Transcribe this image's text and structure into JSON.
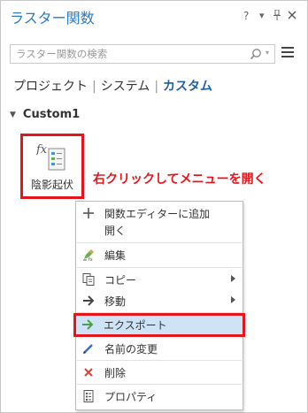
{
  "pane": {
    "title": "ラスター関数",
    "controls": {
      "help": "?",
      "menu": "▾",
      "pin": "ᵖ",
      "close": "✕"
    }
  },
  "search": {
    "placeholder": "ラスター関数の検索"
  },
  "tabs": [
    {
      "label": "プロジェクト",
      "active": false
    },
    {
      "label": "システム",
      "active": false
    },
    {
      "label": "カスタム",
      "active": true
    }
  ],
  "group": {
    "name": "Custom1",
    "expanded": true
  },
  "function": {
    "label": "陰影起伏",
    "icon_text": "fx"
  },
  "annotation": "右クリックしてメニューを開く",
  "context_menu": {
    "items": [
      {
        "label": "関数エディターに追加",
        "icon": "plus-icon"
      },
      {
        "label": "開く",
        "icon": ""
      },
      {
        "label": "編集",
        "icon": "edit-icon"
      },
      {
        "label": "コピー",
        "icon": "copy-icon",
        "submenu": true
      },
      {
        "label": "移動",
        "icon": "move-arrow-icon",
        "submenu": true
      },
      {
        "label": "エクスポート",
        "icon": "export-arrow-icon",
        "highlighted": true
      },
      {
        "label": "名前の変更",
        "icon": "rename-pencil-icon"
      },
      {
        "label": "削除",
        "icon": "delete-x-icon"
      },
      {
        "label": "プロパティ",
        "icon": "properties-icon"
      }
    ]
  },
  "colors": {
    "title": "#2a7ac6",
    "active_tab": "#1f5fa6",
    "annotation": "#e5161b",
    "highlight_bg": "#cfe3f6",
    "delete": "#d9453b",
    "export": "#4aa14a"
  }
}
